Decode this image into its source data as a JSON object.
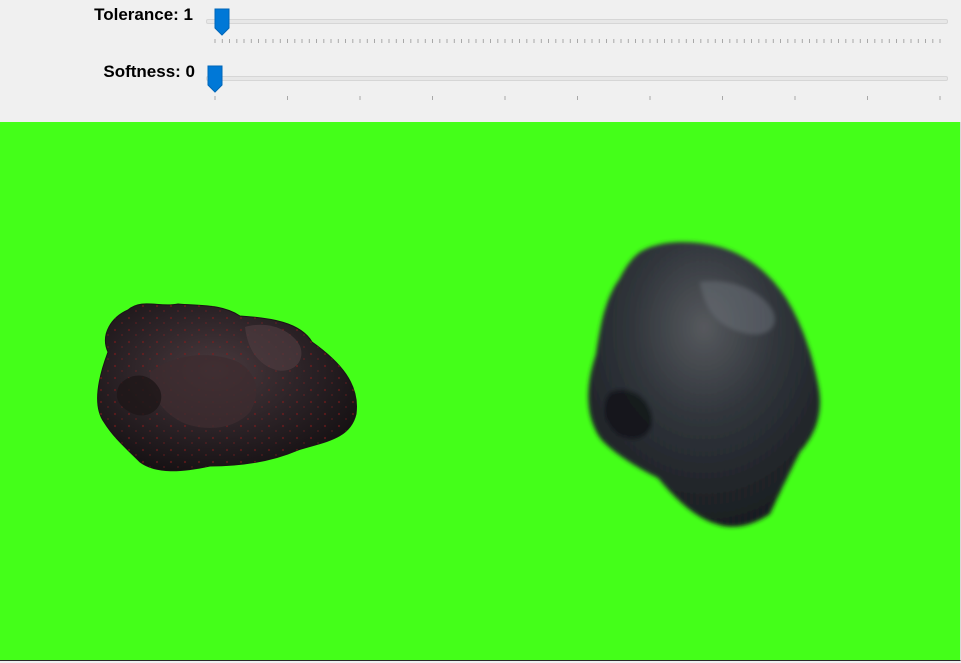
{
  "controls": {
    "tolerance": {
      "label": "Tolerance: 1",
      "value": 1,
      "min": 0,
      "max": 100,
      "tick_count": 101
    },
    "softness": {
      "label": "Softness: 0",
      "value": 0,
      "min": 0,
      "max": 10,
      "tick_count": 11
    },
    "accent_color": "#0078d7"
  },
  "viewport": {
    "background_color": "#44ff19",
    "objects": [
      {
        "name": "asteroid-left",
        "description_icon": "asteroid-icon"
      },
      {
        "name": "asteroid-right",
        "description_icon": "asteroid-icon"
      }
    ]
  }
}
